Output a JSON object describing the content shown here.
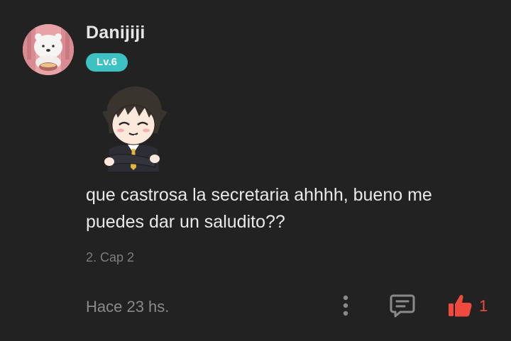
{
  "comment": {
    "username": "Danijiji",
    "level": "Lv.6",
    "message_lines": [
      "que castrosa la secretaria ahhhh, bueno me",
      "puedes dar un saludito??"
    ],
    "chapter": "2. Cap 2",
    "timestamp": "Hace 23 hs.",
    "like_count": "1"
  },
  "icons": {
    "avatar": "bear-avatar-image",
    "sticker": "anime-boy-sticker",
    "more": "more-vertical-icon",
    "reply": "comment-reply-icon",
    "like": "thumbs-up-icon"
  },
  "colors": {
    "background": "#222222",
    "level_badge": "#3ec1c3",
    "like_accent": "#f04a3f",
    "username": "#e6e6e6",
    "meta_text": "#8a8a8a"
  }
}
